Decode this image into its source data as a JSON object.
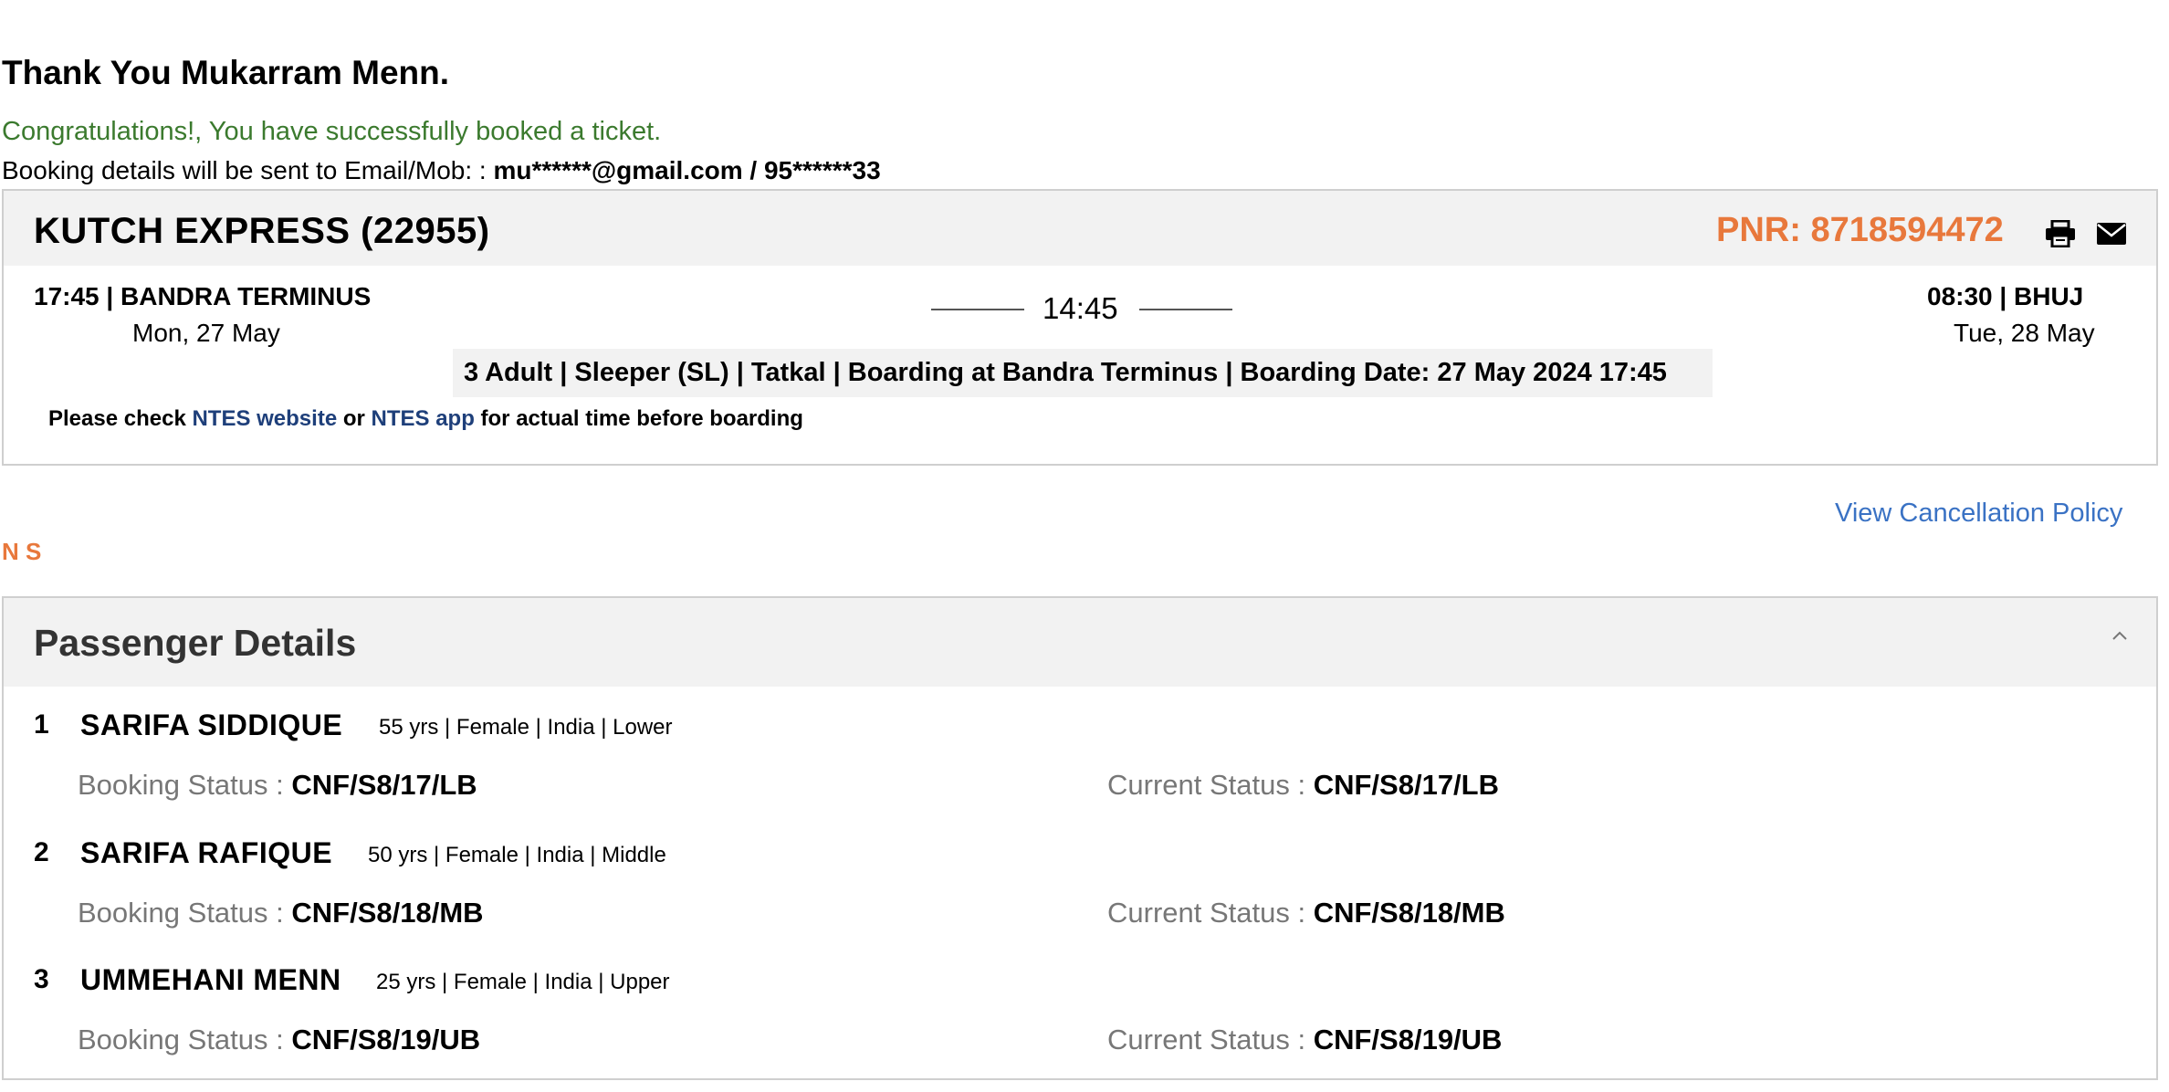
{
  "header": {
    "thanks": "Thank You Mukarram Menn.",
    "congrats": "Congratulations!, You have successfully booked a ticket.",
    "sent_prefix": "Booking details will be sent to Email/Mob: : ",
    "sent_contact": "mu******@gmail.com / 95******33"
  },
  "train": {
    "name": "KUTCH EXPRESS (22955)",
    "pnr": "PNR: 8718594472",
    "print_icon": "print-icon",
    "email_icon": "envelope-icon",
    "departure_time": "17:45 | BANDRA TERMINUS",
    "departure_date": "Mon, 27 May",
    "duration": "14:45",
    "arrival_time": "08:30 | BHUJ",
    "arrival_date": "Tue, 28 May",
    "journey_info": "3 Adult | Sleeper (SL) | Tatkal | Boarding at Bandra Terminus | Boarding Date: 27 May 2024 17:45",
    "note_prefix": "Please check ",
    "note_link1": "NTES website",
    "note_mid": " or ",
    "note_link2": "NTES app",
    "note_suffix": " for actual time before boarding"
  },
  "links": {
    "cancellation_policy": "View Cancellation Policy",
    "ns": "N S"
  },
  "passengers_section": {
    "title": "Passenger Details",
    "collapse_icon": "chevron-up-icon",
    "booking_status_label": "Booking Status : ",
    "current_status_label": "Current Status : ",
    "passengers": [
      {
        "num": "1",
        "name": "SARIFA SIDDIQUE",
        "meta": "55 yrs | Female | India | Lower",
        "booking_status": "CNF/S8/17/LB",
        "current_status": "CNF/S8/17/LB"
      },
      {
        "num": "2",
        "name": "SARIFA RAFIQUE",
        "meta": "50 yrs | Female | India | Middle",
        "booking_status": "CNF/S8/18/MB",
        "current_status": "CNF/S8/18/MB"
      },
      {
        "num": "3",
        "name": "UMMEHANI MENN",
        "meta": "25 yrs | Female | India | Upper",
        "booking_status": "CNF/S8/19/UB",
        "current_status": "CNF/S8/19/UB"
      }
    ]
  }
}
